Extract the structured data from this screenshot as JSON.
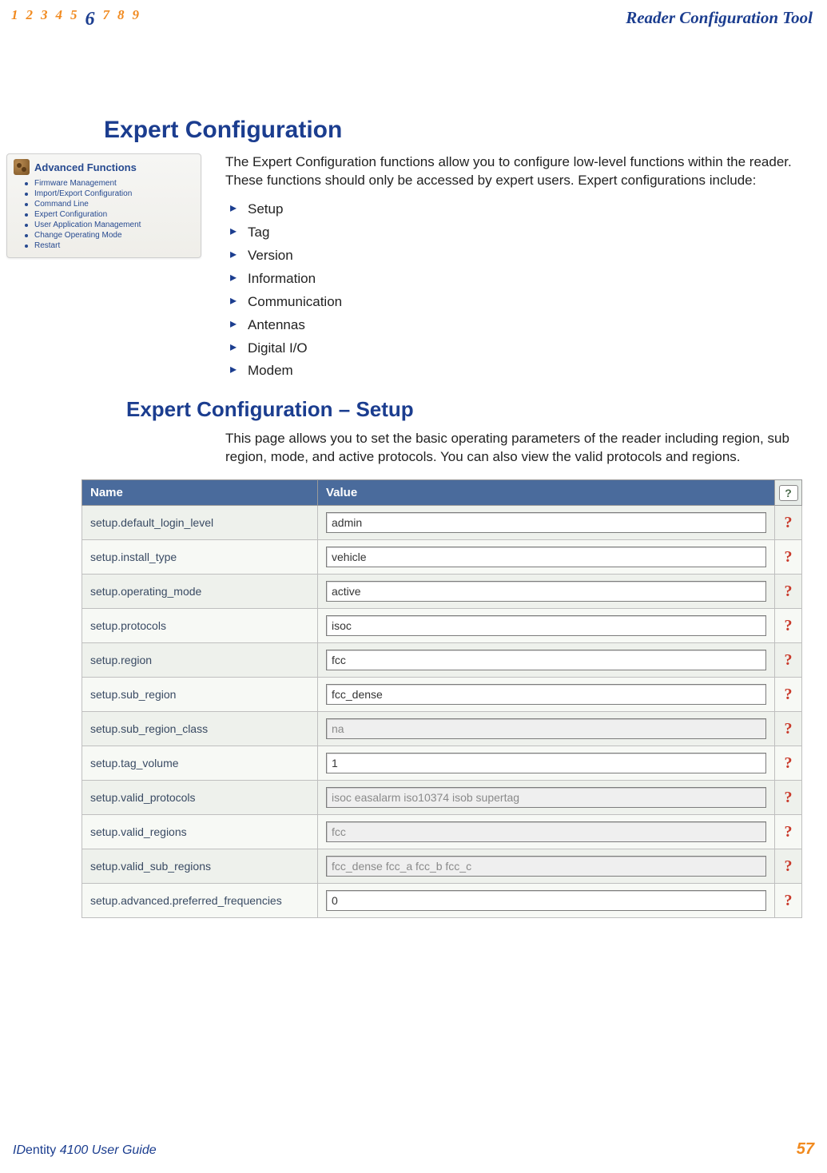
{
  "chapters": [
    "1",
    "2",
    "3",
    "4",
    "5",
    "6",
    "7",
    "8",
    "9"
  ],
  "current_chapter_index": 5,
  "tool_title": "Reader Configuration Tool",
  "section_title": "Expert Configuration",
  "intro": "The Expert Configuration functions allow you to configure low-level functions within the reader. These functions should only be accessed by expert users. Expert configurations include:",
  "side_panel": {
    "title": "Advanced Functions",
    "items": [
      "Firmware Management",
      "Import/Export Configuration",
      "Command Line",
      "Expert Configuration",
      "User Application Management",
      "Change Operating Mode",
      "Restart"
    ]
  },
  "feature_list": [
    "Setup",
    "Tag",
    "Version",
    "Information",
    "Communication",
    "Antennas",
    "Digital I/O",
    "Modem"
  ],
  "subsection_title": "Expert Configuration – Setup",
  "subsection_para": "This page allows you to set the basic operating parameters of the reader including region, sub region, mode, and active protocols. You can also view the valid protocols and regions.",
  "table": {
    "headers": {
      "name": "Name",
      "value": "Value",
      "help": "?"
    },
    "rows": [
      {
        "name": "setup.default_login_level",
        "value": "admin",
        "disabled": false
      },
      {
        "name": "setup.install_type",
        "value": "vehicle",
        "disabled": false
      },
      {
        "name": "setup.operating_mode",
        "value": "active",
        "disabled": false
      },
      {
        "name": "setup.protocols",
        "value": "isoc",
        "disabled": false
      },
      {
        "name": "setup.region",
        "value": "fcc",
        "disabled": false
      },
      {
        "name": "setup.sub_region",
        "value": "fcc_dense",
        "disabled": false
      },
      {
        "name": "setup.sub_region_class",
        "value": "na",
        "disabled": true
      },
      {
        "name": "setup.tag_volume",
        "value": "1",
        "disabled": false
      },
      {
        "name": "setup.valid_protocols",
        "value": "isoc easalarm iso10374 isob supertag",
        "disabled": true
      },
      {
        "name": "setup.valid_regions",
        "value": "fcc",
        "disabled": true
      },
      {
        "name": "setup.valid_sub_regions",
        "value": "fcc_dense fcc_a fcc_b fcc_c",
        "disabled": true
      },
      {
        "name": "setup.advanced.preferred_frequencies",
        "value": "0",
        "disabled": false
      }
    ]
  },
  "footer": {
    "guide_prefix": "ID",
    "guide_mid": "entity",
    "guide_suffix": " 4100 User Guide",
    "page": "57"
  }
}
